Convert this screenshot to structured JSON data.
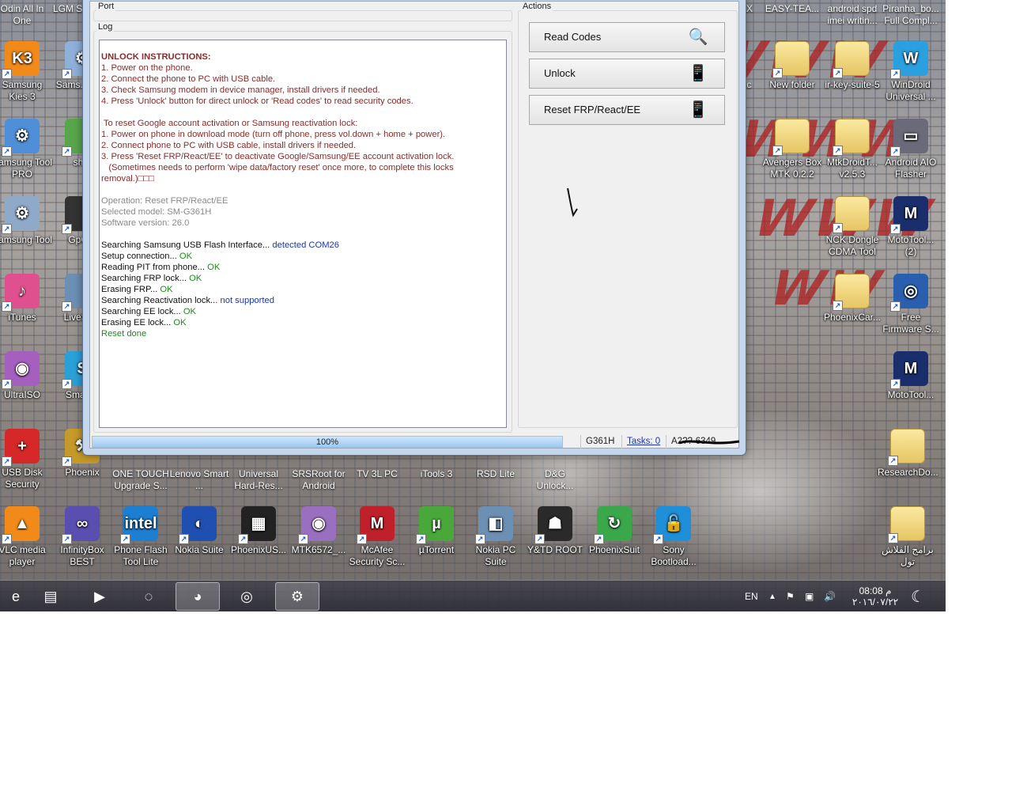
{
  "desktop_icons": [
    {
      "name": "icon-odin",
      "label": "Odin All In One",
      "glyph": "",
      "color": "#4a6d9a"
    },
    {
      "name": "icon-lgm",
      "label": "LGM Suppo...",
      "glyph": "",
      "color": "#4a6d9a"
    },
    {
      "name": "icon-kies",
      "label": "Samsung Kies 3",
      "glyph": "K3",
      "color": "#f28a1a"
    },
    {
      "name": "icon-samsung-tool-top",
      "label": "Sams... To...",
      "glyph": "⚙",
      "color": "#8fb0d8"
    },
    {
      "name": "icon-samsung-tool-pro",
      "label": "Samsung Tool PRO",
      "glyph": "⚙",
      "color": "#4f8fd8"
    },
    {
      "name": "icon-sh",
      "label": "sh...",
      "glyph": "",
      "color": "#58a64a"
    },
    {
      "name": "icon-samsung-tool",
      "label": "Samsung Tool",
      "glyph": "⚙",
      "color": "#8fa9c9"
    },
    {
      "name": "icon-gpg",
      "label": "GpG...",
      "glyph": "",
      "color": "#333333"
    },
    {
      "name": "icon-itunes",
      "label": "iTunes",
      "glyph": "♪",
      "color": "#e0508e"
    },
    {
      "name": "icon-livesuit",
      "label": "LiveSu...",
      "glyph": "",
      "color": "#6c8fb4"
    },
    {
      "name": "icon-ultraiso",
      "label": "UltraISO",
      "glyph": "◉",
      "color": "#a55fbf"
    },
    {
      "name": "icon-smart",
      "label": "Smart...",
      "glyph": "S",
      "color": "#2aa0d8"
    },
    {
      "name": "icon-usb-disk-security",
      "label": "USB Disk Security",
      "glyph": "+",
      "color": "#d62828"
    },
    {
      "name": "icon-phoenix",
      "label": "Phoenix",
      "glyph": "⚒",
      "color": "#c59a2a"
    },
    {
      "name": "icon-vlc",
      "label": "VLC media player",
      "glyph": "▲",
      "color": "#f28a1a"
    },
    {
      "name": "icon-infinitybox",
      "label": "InfinityBox BEST",
      "glyph": "∞",
      "color": "#5a4fb0"
    },
    {
      "name": "icon-one-touch",
      "label": "ONE TOUCH Upgrade S...",
      "glyph": "",
      "color": "#4a6d9a"
    },
    {
      "name": "icon-lenovo",
      "label": "Lenovo Smart ...",
      "glyph": "",
      "color": "#4a6d9a"
    },
    {
      "name": "icon-universal",
      "label": "Universal Hard-Res...",
      "glyph": "",
      "color": "#4a6d9a"
    },
    {
      "name": "icon-srsroot",
      "label": "SRSRoot for Android",
      "glyph": "",
      "color": "#4a6d9a"
    },
    {
      "name": "icon-tv3l",
      "label": "TV 3L PC",
      "glyph": "",
      "color": "#4a6d9a"
    },
    {
      "name": "icon-itools",
      "label": "iTools 3",
      "glyph": "",
      "color": "#4a6d9a"
    },
    {
      "name": "icon-rsd-lite",
      "label": "RSD Lite",
      "glyph": "",
      "color": "#4a6d9a"
    },
    {
      "name": "icon-dg-unlock",
      "label": "D&G Unlock...",
      "glyph": "",
      "color": "#4a6d9a"
    },
    {
      "name": "icon-phone-flash",
      "label": "Phone Flash Tool Lite",
      "glyph": "intel",
      "color": "#1d7fd1"
    },
    {
      "name": "icon-nokia-suite",
      "label": "Nokia Suite",
      "glyph": "◐",
      "color": "#1f4fb0"
    },
    {
      "name": "icon-phoenixusb",
      "label": "PhoenixUS...",
      "glyph": "▦",
      "color": "#222222"
    },
    {
      "name": "icon-mtk6572",
      "label": "MTK6572_...",
      "glyph": "◉",
      "color": "#9a6fc0"
    },
    {
      "name": "icon-mcafee",
      "label": "McAfee Security Sc...",
      "glyph": "M",
      "color": "#c0202a"
    },
    {
      "name": "icon-utorrent",
      "label": "µTorrent",
      "glyph": "µ",
      "color": "#4aa83a"
    },
    {
      "name": "icon-nokia-pc-suite",
      "label": "Nokia PC Suite",
      "glyph": "◧",
      "color": "#6c8fb4"
    },
    {
      "name": "icon-ytd-root",
      "label": "Y&TD ROOT",
      "glyph": "☗",
      "color": "#2a2a2a"
    },
    {
      "name": "icon-phoenixsuit",
      "label": "PhoenixSuit",
      "glyph": "↻",
      "color": "#3aa84a"
    },
    {
      "name": "icon-sony-bootloader",
      "label": "Sony Bootload...",
      "glyph": "🔓",
      "color": "#1e8fd8"
    },
    {
      "name": "icon-easy-team",
      "label": "EASY-TEA...",
      "glyph": "",
      "color": "#4a6d9a"
    },
    {
      "name": "icon-android-spd",
      "label": "android spd imei writin...",
      "glyph": "",
      "color": "#4a6d9a"
    },
    {
      "name": "icon-piranha",
      "label": "Piranha_bo... Full Compl...",
      "glyph": "",
      "color": "#4a6d9a"
    },
    {
      "name": "icon-new-folder",
      "label": "New folder",
      "glyph": "",
      "color": "folder"
    },
    {
      "name": "icon-ir-key-suite",
      "label": "ir-key-suite-5",
      "glyph": "",
      "color": "folder"
    },
    {
      "name": "icon-windroid",
      "label": "WinDroid Universal ...",
      "glyph": "W",
      "color": "#2aa0e0"
    },
    {
      "name": "icon-avengers-box",
      "label": "Avengers Box MTK 0.2.2",
      "glyph": "",
      "color": "folder"
    },
    {
      "name": "icon-mtkdroidtools",
      "label": "MtkDroidT... v2.5.3",
      "glyph": "",
      "color": "folder"
    },
    {
      "name": "icon-android-aio",
      "label": "Android AIO Flasher",
      "glyph": "▭",
      "color": "#6a6a7a"
    },
    {
      "name": "icon-nck-dongle",
      "label": "NCK Dongle CDMA Tool",
      "glyph": "",
      "color": "folder"
    },
    {
      "name": "icon-mototool-2",
      "label": "MotoTool... (2)",
      "glyph": "M",
      "color": "#1a2e6e"
    },
    {
      "name": "icon-phoenixcard",
      "label": "PhoenixCar...",
      "glyph": "",
      "color": "folder"
    },
    {
      "name": "icon-free-firmware",
      "label": "Free Firmware S...",
      "glyph": "◎",
      "color": "#2a5fb0"
    },
    {
      "name": "icon-mototool",
      "label": "MotoTool...",
      "glyph": "M",
      "color": "#1a2e6e"
    },
    {
      "name": "icon-researchdo",
      "label": "ResearchDo...",
      "glyph": "",
      "color": "folder"
    },
    {
      "name": "icon-arabic-flash",
      "label": "برامج الفلاش تول",
      "glyph": "",
      "color": "folder"
    },
    {
      "name": "icon-partial-ax",
      "label": "AX",
      "glyph": "",
      "color": "none"
    },
    {
      "name": "icon-partial-ac",
      "label": "ac",
      "glyph": "",
      "color": "none"
    }
  ],
  "window": {
    "port_group": "Port",
    "log_group": "Log",
    "actions_group": "Actions",
    "buttons": [
      {
        "name": "read-codes-button",
        "label": "Read Codes",
        "icon": "search-codes-icon",
        "glyph": "🔍"
      },
      {
        "name": "unlock-button",
        "label": "Unlock",
        "icon": "phone-unlock-icon",
        "glyph": "📱"
      },
      {
        "name": "reset-frp-button",
        "label": "Reset FRP/React/EE",
        "icon": "phone-reset-icon",
        "glyph": "📱"
      }
    ],
    "log": [
      {
        "text": "UNLOCK INSTRUCTIONS:",
        "style": "maroon-bold"
      },
      {
        "text": "1. Power on the phone.",
        "style": "maroon"
      },
      {
        "text": "2. Connect the phone to PC with USB cable.",
        "style": "maroon"
      },
      {
        "text": "3. Check Samsung modem in device manager, install drivers if needed.",
        "style": "maroon"
      },
      {
        "text": "4. Press 'Unlock' button for direct unlock or 'Read codes' to read security codes.",
        "style": "maroon"
      },
      {
        "text": "",
        "style": "maroon"
      },
      {
        "text": " To reset Google account activation or Samsung reactivation lock:",
        "style": "maroon"
      },
      {
        "text": "1. Power on phone in download mode (turn off phone, press vol.down + home + power).",
        "style": "maroon"
      },
      {
        "text": "2. Connect phone to PC with USB cable, install drivers if needed.",
        "style": "maroon"
      },
      {
        "text": "3. Press 'Reset FRP/React/EE' to deactivate Google/Samsung/EE account activation lock.",
        "style": "maroon"
      },
      {
        "text": "   (Sometimes needs to perform 'wipe data/factory reset' once more, to complete this locks",
        "style": "maroon"
      },
      {
        "text": "removal.)□□□",
        "style": "maroon"
      },
      {
        "text": "",
        "style": "grey"
      },
      {
        "text": "Operation: Reset FRP/React/EE",
        "style": "grey"
      },
      {
        "text": "Selected model: SM-G361H",
        "style": "grey"
      },
      {
        "text": "Software version: 26.0",
        "style": "grey"
      },
      {
        "text": "",
        "style": "grey"
      },
      {
        "text": "Searching Samsung USB Flash Interface... ",
        "style": "dark",
        "result": "detected COM26",
        "result_style": "blue"
      },
      {
        "text": "Setup connection... ",
        "style": "dark",
        "result": "OK",
        "result_style": "green"
      },
      {
        "text": "Reading PIT from phone... ",
        "style": "dark",
        "result": "OK",
        "result_style": "green"
      },
      {
        "text": "Searching FRP lock... ",
        "style": "dark",
        "result": "OK",
        "result_style": "green"
      },
      {
        "text": "Erasing FRP... ",
        "style": "dark",
        "result": "OK",
        "result_style": "green"
      },
      {
        "text": "Searching Reactivation lock... ",
        "style": "dark",
        "result": "not supported",
        "result_style": "blue"
      },
      {
        "text": "Searching EE lock... ",
        "style": "dark",
        "result": "OK",
        "result_style": "green"
      },
      {
        "text": "Erasing EE lock... ",
        "style": "dark",
        "result": "OK",
        "result_style": "green"
      },
      {
        "text": "Reset done",
        "style": "green"
      }
    ],
    "status": {
      "progress_label": "100%",
      "progress_value": 1.0,
      "model": "G361H",
      "tasks_link": "Tasks: 0",
      "serial": "A2??-6349"
    }
  },
  "taskbar": {
    "apps": [
      {
        "name": "taskbar-ie-icon",
        "glyph": "e",
        "active": false
      },
      {
        "name": "taskbar-explorer-icon",
        "glyph": "▤",
        "active": false
      },
      {
        "name": "taskbar-media-player-icon",
        "glyph": "▶",
        "active": false
      },
      {
        "name": "taskbar-app-swirl-icon",
        "glyph": "◌",
        "active": false
      },
      {
        "name": "taskbar-chrome-icon",
        "glyph": "◕",
        "active": true
      },
      {
        "name": "taskbar-360-icon",
        "glyph": "◎",
        "active": false
      },
      {
        "name": "taskbar-samsung-tool-icon",
        "glyph": "⚙",
        "active": true
      }
    ],
    "language": "EN",
    "time": "08:08 م",
    "date": "٢٠١٦/٠٧/٢٢"
  }
}
